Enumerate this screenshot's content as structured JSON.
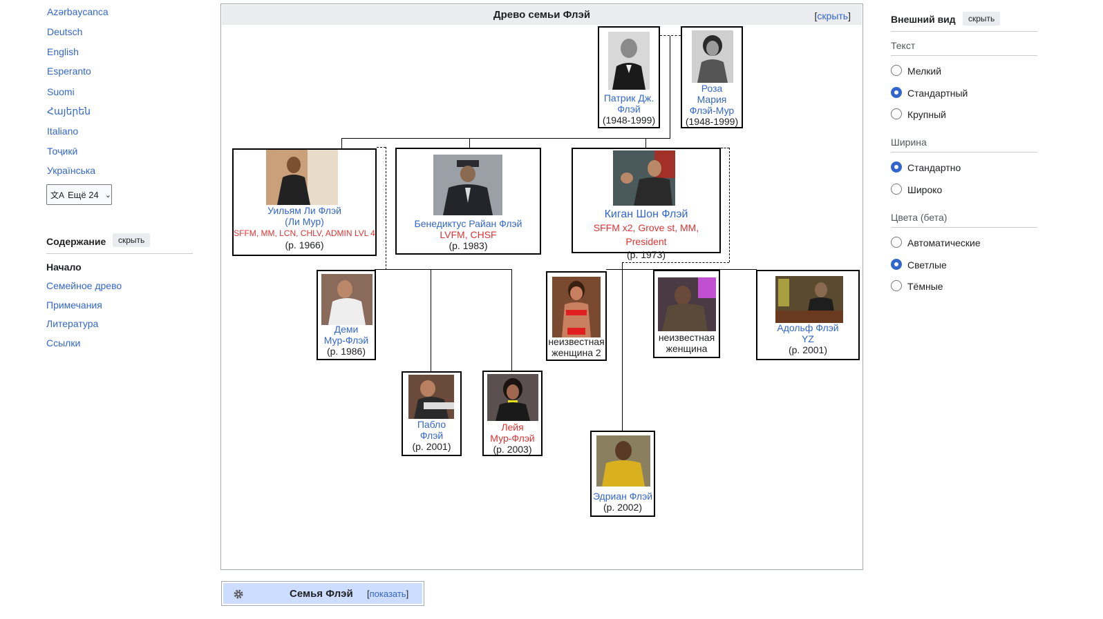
{
  "languages": [
    "Azərbaycanca",
    "Deutsch",
    "English",
    "Esperanto",
    "Suomi",
    "Հայերեն",
    "Italiano",
    "Тоҷикӣ",
    "Українська"
  ],
  "more_languages": "Ещё 24",
  "toc": {
    "title": "Содержание",
    "hide": "скрыть",
    "items": [
      "Начало",
      "Семейное древо",
      "Примечания",
      "Литература",
      "Ссылки"
    ]
  },
  "tree": {
    "title": "Древо семьи Флэй",
    "toggle_open": "[",
    "toggle_label": "скрыть",
    "toggle_close": "]",
    "people": {
      "patrick": {
        "name1": "Патрик Дж.",
        "name2": "Флэй",
        "years": "(1948-1999)"
      },
      "rosa": {
        "name1": "Роза",
        "name2": "Мария",
        "name3": "Флэй-Мур",
        "years": "(1948-1999)"
      },
      "william": {
        "name1": "Уильям Ли Флэй",
        "name2": "(Ли Мур)",
        "tags": "SFFM, MM, LCN, CHLV, ADMIN LVL 4",
        "years": "(р. 1966)"
      },
      "benedict": {
        "name1": "Бенедиктус Райан Флэй",
        "tags": "LVFM, CHSF",
        "years": "(р. 1983)"
      },
      "keegan": {
        "name1": "Киган Шон Флэй",
        "tags": "SFFM x2, Grove st, MM, President",
        "years": "(р. 1973)"
      },
      "demi": {
        "name1": "Деми",
        "name2": "Мур-Флэй",
        "years": "(р. 1986)"
      },
      "unknown2": {
        "line1": "неизвестная",
        "line2": "женщина 2"
      },
      "unknown": {
        "line1": "неизвестная",
        "line2": "женщина"
      },
      "adolf": {
        "name1": "Адольф Флэй",
        "tags": "YZ",
        "years": "(р. 2001)"
      },
      "pablo": {
        "name1": "Пабло",
        "name2": "Флэй",
        "years": "(р. 2001)"
      },
      "leia": {
        "name1": "Лейя",
        "name2": "Мур-Флэй",
        "years": "(р. 2003)"
      },
      "adrian": {
        "name1": "Эдриан Флэй",
        "years": "(р. 2002)"
      }
    }
  },
  "navbox": {
    "title": "Семья Флэй",
    "toggle_open": "[",
    "toggle_label": "показать",
    "toggle_close": "]"
  },
  "appearance": {
    "title": "Внешний вид",
    "hide": "скрыть",
    "text_label": "Текст",
    "text_options": [
      "Мелкий",
      "Стандартный",
      "Крупный"
    ],
    "text_selected": "Стандартный",
    "width_label": "Ширина",
    "width_options": [
      "Стандартно",
      "Широко"
    ],
    "width_selected": "Стандартно",
    "colors_label": "Цвета (бета)",
    "color_options": [
      "Автоматические",
      "Светлые",
      "Тёмные"
    ],
    "color_selected": "Светлые"
  }
}
